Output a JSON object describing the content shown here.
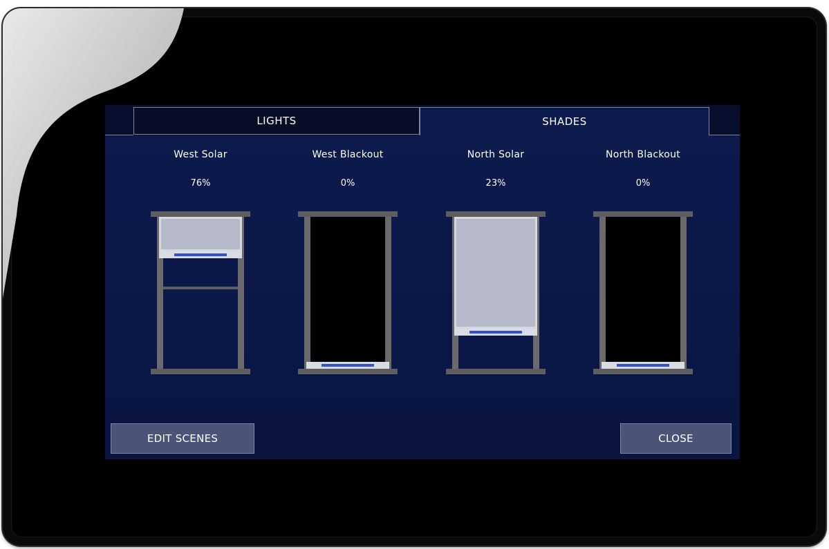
{
  "tabs": [
    {
      "label": "LIGHTS",
      "active": false
    },
    {
      "label": "SHADES",
      "active": true
    }
  ],
  "shades": [
    {
      "name": "West Solar",
      "percent_label": "76%",
      "type": "solar",
      "closed_fraction": 0.24
    },
    {
      "name": "West Blackout",
      "percent_label": "0%",
      "type": "blackout",
      "closed_fraction": 1.0
    },
    {
      "name": "North Solar",
      "percent_label": "23%",
      "type": "solar",
      "closed_fraction": 0.77
    },
    {
      "name": "North Blackout",
      "percent_label": "0%",
      "type": "blackout",
      "closed_fraction": 1.0
    }
  ],
  "buttons": {
    "edit_scenes": "EDIT SCENES",
    "close": "CLOSE"
  },
  "colors": {
    "screen_background": "#0c1a4d",
    "button_background": "#4a5477",
    "shade_fabric": "#b5b9c9",
    "bottom_bar_stripe": "#3552c8",
    "frame": "#5e5e60"
  }
}
